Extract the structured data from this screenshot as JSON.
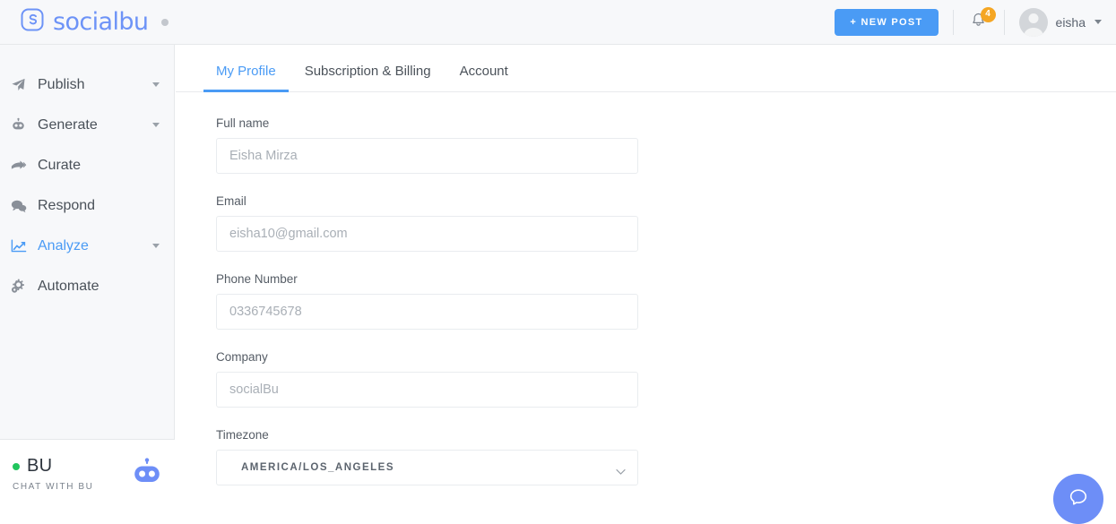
{
  "header": {
    "brand_name": "socialbu",
    "brand_icon": "socialbu-logo-icon",
    "status_dot": "status-dot",
    "new_post_label": "+  NEW POST",
    "notification_icon": "bell-icon",
    "notification_count": "4",
    "avatar_icon": "user-avatar",
    "user_name": "eisha",
    "user_caret_icon": "chevron-down-icon"
  },
  "sidebar": {
    "items": [
      {
        "label": "Publish",
        "icon": "paper-plane-icon",
        "active": false,
        "has_chevron": true
      },
      {
        "label": "Generate",
        "icon": "robot-icon",
        "active": false,
        "has_chevron": true
      },
      {
        "label": "Curate",
        "icon": "forward-arrow-icon",
        "active": false,
        "has_chevron": false
      },
      {
        "label": "Respond",
        "icon": "chat-bubbles-icon",
        "active": false,
        "has_chevron": false
      },
      {
        "label": "Analyze",
        "icon": "line-chart-icon",
        "active": true,
        "has_chevron": true
      },
      {
        "label": "Automate",
        "icon": "gears-icon",
        "active": false,
        "has_chevron": false
      }
    ],
    "chat": {
      "title": "BU",
      "subtitle": "CHAT WITH BU",
      "status_icon": "online-status-dot",
      "bot_icon": "robot-icon"
    }
  },
  "main": {
    "tabs": [
      {
        "label": "My Profile",
        "active": true
      },
      {
        "label": "Subscription & Billing",
        "active": false
      },
      {
        "label": "Account",
        "active": false
      }
    ],
    "fields": [
      {
        "label": "Full name",
        "placeholder": "Eisha Mirza",
        "value": ""
      },
      {
        "label": "Email",
        "placeholder": "eisha10@gmail.com",
        "value": ""
      },
      {
        "label": "Phone Number",
        "placeholder": "0336745678",
        "value": ""
      },
      {
        "label": "Company",
        "placeholder": "socialBu",
        "value": ""
      }
    ],
    "timezone": {
      "label": "Timezone",
      "selected": "AMERICA/LOS_ANGELES",
      "chevron_icon": "chevron-down-icon"
    }
  },
  "fab": {
    "icon": "chat-support-icon"
  },
  "colors": {
    "accent": "#4a9bf5",
    "brand": "#6d93f7",
    "badge": "#f5a623",
    "online": "#21c55d",
    "fab": "#6d8ef7",
    "header_bg": "#f7f8fa",
    "border": "#e6e8eb"
  }
}
